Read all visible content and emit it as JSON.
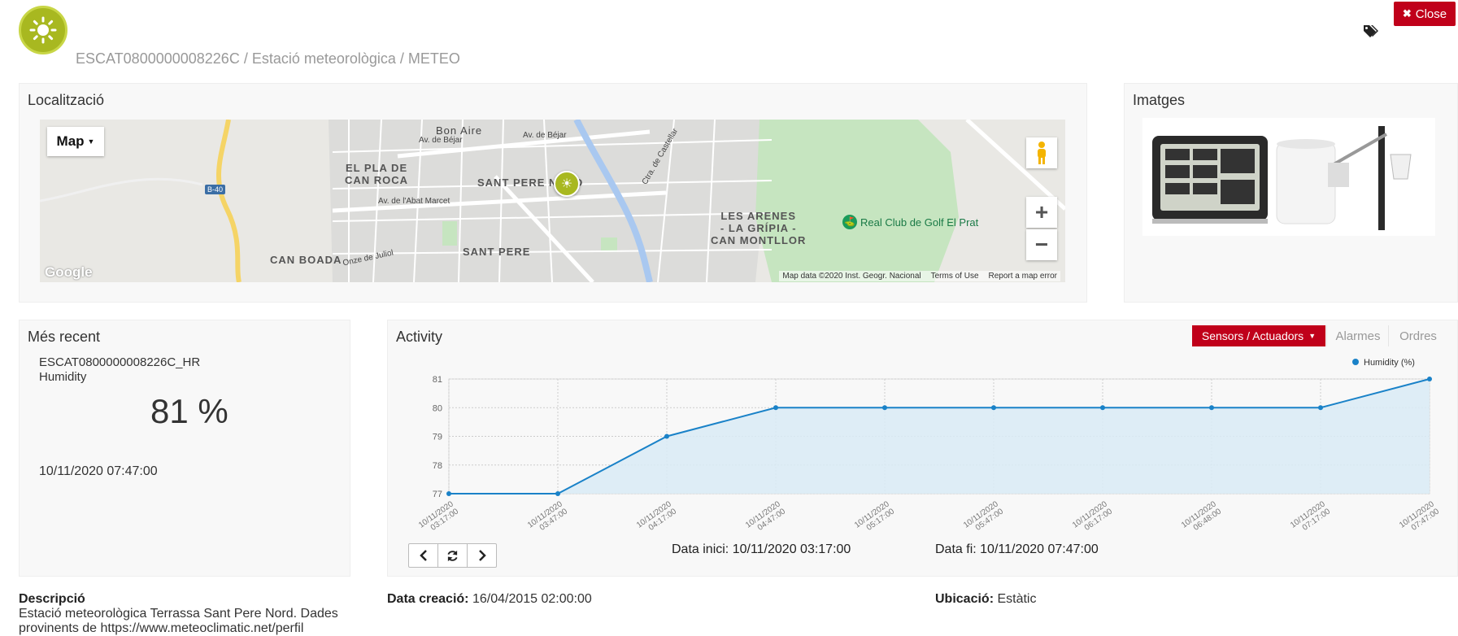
{
  "header": {
    "subtitle": "ESCAT0800000008226C / Estació meteorològica / METEO",
    "close_label": "Close"
  },
  "location_panel": {
    "title": "Localització",
    "map_type": "Map",
    "labels": {
      "el_pla": "EL PLA DE\nCAN ROCA",
      "sant_pere_nord": "SANT PERE NORD",
      "sant_pere": "SANT PERE",
      "can_boada": "CAN BOADA",
      "les_arenes": "LES ARENES\n- LA GRÍPIA -\nCAN MONTLLOR",
      "bon_aire": "Bon Aire",
      "golf": "Real Club de Golf El Prat",
      "road_b40": "B-40",
      "av_bejar": "Av. de Béjar",
      "av_bejar2": "Av. de Béjar",
      "av_abat": "Av. de l'Abat Marcet",
      "ctra_castellar": "Ctra. de Castellar",
      "juliol": "Onze de Juliol"
    },
    "attribution": {
      "data": "Map data ©2020 Inst. Geogr. Nacional",
      "terms": "Terms of Use",
      "report": "Report a map error"
    },
    "google": "Google"
  },
  "images_panel": {
    "title": "Imatges"
  },
  "recent_panel": {
    "title": "Més recent",
    "sensor_id": "ESCAT0800000008226C_HR",
    "sensor_name": "Humidity",
    "value": "81 %",
    "timestamp": "10/11/2020 07:47:00"
  },
  "activity_panel": {
    "title": "Activity",
    "tabs": {
      "sensors": "Sensors / Actuadors",
      "alarms": "Alarmes",
      "orders": "Ordres"
    },
    "start_label": "Data inici:",
    "start_value": "10/11/2020 03:17:00",
    "end_label": "Data fi:",
    "end_value": "10/11/2020 07:47:00"
  },
  "footer": {
    "description_label": "Descripció",
    "description_text": "Estació meteorològica Terrassa Sant Pere Nord. Dades provinents de https://www.meteoclimatic.net/perfil",
    "creation_label": "Data creació:",
    "creation_value": "16/04/2015 02:00:00",
    "location_label": "Ubicació:",
    "location_value": "Estàtic"
  },
  "colors": {
    "accent": "#c0001a",
    "logo": "#a8b820",
    "series": "#1a82c8",
    "fill": "#d9ebf6"
  },
  "chart_data": {
    "type": "area",
    "legend_placement": "top-right",
    "series": [
      {
        "name": "Humidity (%)",
        "values": [
          77,
          77,
          79,
          80,
          80,
          80,
          80,
          80,
          80,
          81
        ]
      }
    ],
    "x": [
      "10/11/2020 03:17:00",
      "10/11/2020 03:47:00",
      "10/11/2020 04:17:00",
      "10/11/2020 04:47:00",
      "10/11/2020 05:17:00",
      "10/11/2020 05:47:00",
      "10/11/2020 06:17:00",
      "10/11/2020 06:48:00",
      "10/11/2020 07:17:00",
      "10/11/2020 07:47:00"
    ],
    "x_tick_labels": [
      [
        "10/11/2020",
        "03:17:00"
      ],
      [
        "10/11/2020",
        "03:47:00"
      ],
      [
        "10/11/2020",
        "04:17:00"
      ],
      [
        "10/11/2020",
        "04:47:00"
      ],
      [
        "10/11/2020",
        "05:17:00"
      ],
      [
        "10/11/2020",
        "05:47:00"
      ],
      [
        "10/11/2020",
        "06:17:00"
      ],
      [
        "10/11/2020",
        "06:48:00"
      ],
      [
        "10/11/2020",
        "07:17:00"
      ],
      [
        "10/11/2020",
        "07:47:00"
      ]
    ],
    "y_ticks": [
      77,
      78,
      79,
      80,
      81
    ],
    "ylim": [
      77,
      81
    ],
    "grid": true
  }
}
